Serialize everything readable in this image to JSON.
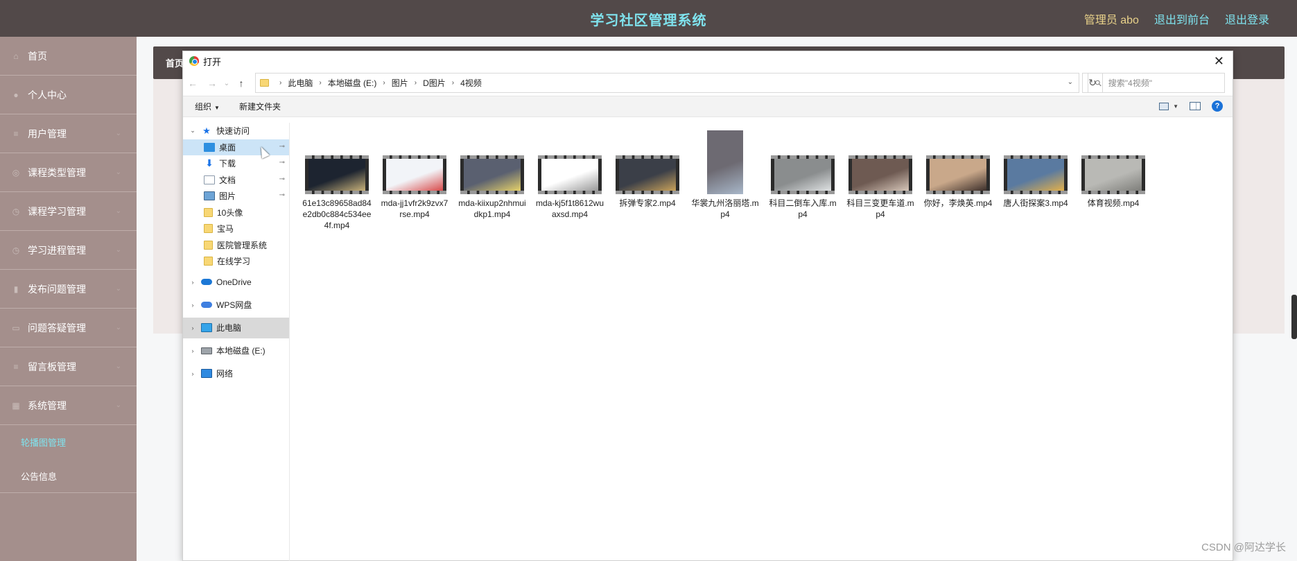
{
  "header": {
    "title": "学习社区管理系统",
    "admin": "管理员 abo",
    "front_link": "退出到前台",
    "logout_link": "退出登录"
  },
  "sidebar": {
    "items": [
      {
        "label": "首页",
        "icon": "home-icon"
      },
      {
        "label": "个人中心",
        "icon": "user-icon"
      },
      {
        "label": "用户管理",
        "icon": "list-icon"
      },
      {
        "label": "课程类型管理",
        "icon": "tag-icon"
      },
      {
        "label": "课程学习管理",
        "icon": "book-icon"
      },
      {
        "label": "学习进程管理",
        "icon": "progress-icon"
      },
      {
        "label": "发布问题管理",
        "icon": "chart-icon"
      },
      {
        "label": "问题答疑管理",
        "icon": "chat-icon"
      },
      {
        "label": "留言板管理",
        "icon": "message-icon"
      },
      {
        "label": "系统管理",
        "icon": "system-icon"
      }
    ],
    "sub_items": [
      {
        "label": "轮播图管理",
        "active": true
      },
      {
        "label": "公告信息",
        "active": false
      }
    ]
  },
  "background": {
    "breadcrumb": "首页"
  },
  "dialog": {
    "title": "打开",
    "close": "✕",
    "nav": {
      "back": "←",
      "forward": "→",
      "recent": "⌄",
      "up": "↑"
    },
    "path": [
      "此电脑",
      "本地磁盘 (E:)",
      "图片",
      "D图片",
      "4视频"
    ],
    "refresh": "↻",
    "search_placeholder": "搜索\"4视频\"",
    "toolbar": {
      "organize": "组织",
      "new_folder": "新建文件夹",
      "help": "?"
    },
    "tree": [
      {
        "label": "快速访问",
        "icon": "star",
        "level": 0,
        "expand": "⌄"
      },
      {
        "label": "桌面",
        "icon": "desk",
        "level": 1,
        "pin": true,
        "hl": true
      },
      {
        "label": "下载",
        "icon": "dl",
        "level": 1,
        "pin": true
      },
      {
        "label": "文档",
        "icon": "doc",
        "level": 1,
        "pin": true
      },
      {
        "label": "图片",
        "icon": "pic",
        "level": 1,
        "pin": true
      },
      {
        "label": "10头像",
        "icon": "fold",
        "level": 1
      },
      {
        "label": "宝马",
        "icon": "fold",
        "level": 1
      },
      {
        "label": "医院管理系统",
        "icon": "fold",
        "level": 1
      },
      {
        "label": "在线学习",
        "icon": "fold",
        "level": 1
      },
      {
        "label": "OneDrive",
        "icon": "cloud",
        "level": 0,
        "expand": "›",
        "gap": true
      },
      {
        "label": "WPS网盘",
        "icon": "wps",
        "level": 0,
        "expand": "›",
        "gap": true
      },
      {
        "label": "此电脑",
        "icon": "pc",
        "level": 0,
        "expand": "›",
        "gap": true,
        "sel": true
      },
      {
        "label": "本地磁盘 (E:)",
        "icon": "disk",
        "level": 0,
        "expand": "›",
        "gap": true
      },
      {
        "label": "网络",
        "icon": "net",
        "level": 0,
        "expand": "›",
        "gap": true
      }
    ],
    "files": [
      {
        "name": "61e13c89658ad84e2db0c884c534ee4f.mp4",
        "thumb": "#1d2430",
        "accent": "#c9b27a"
      },
      {
        "name": "mda-jj1vfr2k9zvx7rse.mp4",
        "thumb": "#f2f4f8",
        "accent": "#d84a4a"
      },
      {
        "name": "mda-kiixup2nhmuidkp1.mp4",
        "thumb": "#5a6070",
        "accent": "#e6d26a"
      },
      {
        "name": "mda-kj5f1t8612wuaxsd.mp4",
        "thumb": "#ffffff",
        "accent": "#999999"
      },
      {
        "name": "拆弹专家2.mp4",
        "thumb": "#3b3f48",
        "accent": "#c9a25a"
      },
      {
        "name": "华裳九州洛丽塔.mp4",
        "thumb": "#6d6a72",
        "accent": "#a8b7c9",
        "portrait": true
      },
      {
        "name": "科目二倒车入库.mp4",
        "thumb": "#8a8d8e",
        "accent": "#dfe2e3"
      },
      {
        "name": "科目三变更车道.mp4",
        "thumb": "#6e5a52",
        "accent": "#d6c6b9"
      },
      {
        "name": "你好，李焕英.mp4",
        "thumb": "#c9a88a",
        "accent": "#3b2e2a"
      },
      {
        "name": "唐人街探案3.mp4",
        "thumb": "#5a7aa0",
        "accent": "#e3b04a"
      },
      {
        "name": "体育视频.mp4",
        "thumb": "#b9b9b5",
        "accent": "#7e7e7a"
      }
    ]
  },
  "watermark": "CSDN @阿达学长"
}
